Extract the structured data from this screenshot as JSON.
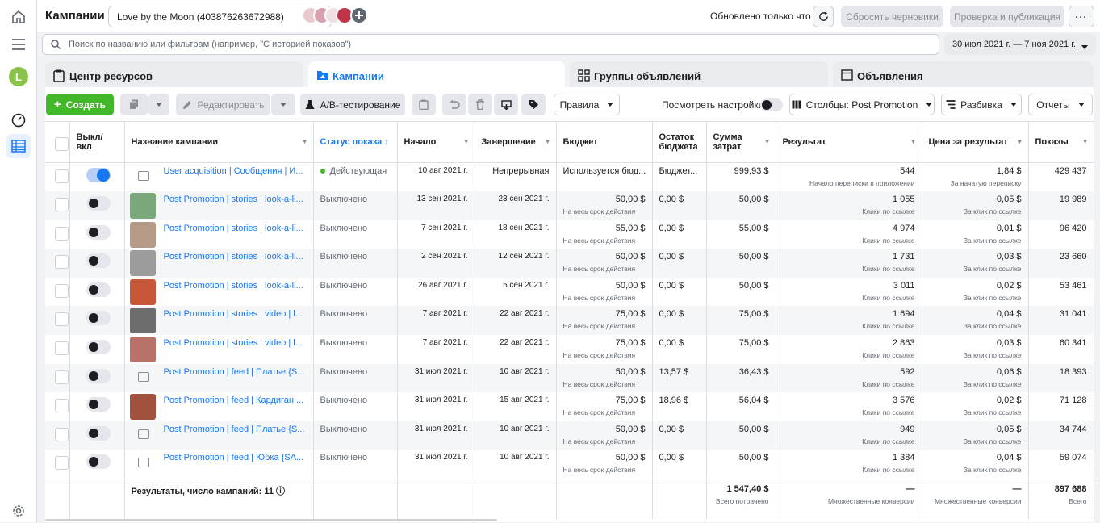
{
  "header": {
    "title": "Кампании",
    "account": "Love by the Moon (403876263672988)",
    "updated": "Обновлено только что",
    "discard_label": "Сбросить черновики",
    "publish_label": "Проверка и публикация",
    "more_label": "···"
  },
  "sidebar": {
    "avatar_letter": "L"
  },
  "search": {
    "placeholder": "Поиск по названию или фильтрам (например, \"С историей показов\")",
    "date_range": "30 июл 2021 г. — 7 ноя 2021 г."
  },
  "tabs": [
    {
      "label": "Центр ресурсов",
      "icon": "clipboard-icon"
    },
    {
      "label": "Кампании",
      "icon": "folder-icon"
    },
    {
      "label": "Группы объявлений",
      "icon": "grid-icon"
    },
    {
      "label": "Объявления",
      "icon": "ad-icon"
    }
  ],
  "toolbar": {
    "create": "Создать",
    "edit": "Редактировать",
    "ab_test": "A/B-тестирование",
    "rules": "Правила",
    "view_settings": "Посмотреть настройки",
    "columns": "Столбцы: Post Promotion",
    "breakdown": "Разбивка",
    "reports": "Отчеты"
  },
  "columns": [
    "Выкл/вкл",
    "Название кампании",
    "Статус показа",
    "Начало",
    "Завершение",
    "Бюджет",
    "Остаток бюджета",
    "Сумма затрат",
    "Результат",
    "Цена за результат",
    "Показы"
  ],
  "rows": [
    {
      "on": true,
      "thumb": "",
      "name": "User acquisition | Сообщения | И...",
      "status": "Действующая",
      "start": "10 авг 2021 г.",
      "end": "Непрерывная",
      "budget": "Используется бюд...",
      "budget_sub": "",
      "remaining": "Бюджет...",
      "spent": "999,93 $",
      "result": "544",
      "result_sub": "Начало переписки в приложении",
      "cpr": "1,84 $",
      "cpr_sub": "За начатую переписку",
      "impr": "429 437"
    },
    {
      "on": false,
      "thumb": "#7aa87a",
      "name": "Post Promotion | stories | look-a-li...",
      "status": "Выключено",
      "start": "13 сен 2021 г.",
      "end": "23 сен 2021 г.",
      "budget": "50,00 $",
      "budget_sub": "На весь срок действия",
      "remaining": "0,00 $",
      "spent": "50,00 $",
      "result": "1 055",
      "result_sub": "Клики по ссылке",
      "cpr": "0,05 $",
      "cpr_sub": "За клик по ссылке",
      "impr": "19 989"
    },
    {
      "on": false,
      "thumb": "#b59a88",
      "name": "Post Promotion | stories | look-a-li...",
      "status": "Выключено",
      "start": "7 сен 2021 г.",
      "end": "18 сен 2021 г.",
      "budget": "55,00 $",
      "budget_sub": "На весь срок действия",
      "remaining": "0,00 $",
      "spent": "55,00 $",
      "result": "4 974",
      "result_sub": "Клики по ссылке",
      "cpr": "0,01 $",
      "cpr_sub": "За клик по ссылке",
      "impr": "96 420"
    },
    {
      "on": false,
      "thumb": "#9c9c9c",
      "name": "Post Promotion | stories | look-a-li...",
      "status": "Выключено",
      "start": "2 сен 2021 г.",
      "end": "12 сен 2021 г.",
      "budget": "50,00 $",
      "budget_sub": "На весь срок действия",
      "remaining": "0,00 $",
      "spent": "50,00 $",
      "result": "1 731",
      "result_sub": "Клики по ссылке",
      "cpr": "0,03 $",
      "cpr_sub": "За клик по ссылке",
      "impr": "23 660"
    },
    {
      "on": false,
      "thumb": "#c8573a",
      "name": "Post Promotion | stories | look-a-li...",
      "status": "Выключено",
      "start": "26 авг 2021 г.",
      "end": "5 сен 2021 г.",
      "budget": "50,00 $",
      "budget_sub": "На весь срок действия",
      "remaining": "0,00 $",
      "spent": "50,00 $",
      "result": "3 011",
      "result_sub": "Клики по ссылке",
      "cpr": "0,02 $",
      "cpr_sub": "За клик по ссылке",
      "impr": "53 461"
    },
    {
      "on": false,
      "thumb": "#6d6d6d",
      "name": "Post Promotion | stories | video | l...",
      "status": "Выключено",
      "start": "7 авг 2021 г.",
      "end": "22 авг 2021 г.",
      "budget": "75,00 $",
      "budget_sub": "На весь срок действия",
      "remaining": "0,00 $",
      "spent": "75,00 $",
      "result": "1 694",
      "result_sub": "Клики по ссылке",
      "cpr": "0,04 $",
      "cpr_sub": "За клик по ссылке",
      "impr": "31 041"
    },
    {
      "on": false,
      "thumb": "#b8726a",
      "name": "Post Promotion | stories | video | l...",
      "status": "Выключено",
      "start": "7 авг 2021 г.",
      "end": "22 авг 2021 г.",
      "budget": "75,00 $",
      "budget_sub": "На весь срок действия",
      "remaining": "0,00 $",
      "spent": "75,00 $",
      "result": "2 863",
      "result_sub": "Клики по ссылке",
      "cpr": "0,03 $",
      "cpr_sub": "За клик по ссылке",
      "impr": "60 341"
    },
    {
      "on": false,
      "thumb": "",
      "name": "Post Promotion | feed | Платье {S...",
      "status": "Выключено",
      "start": "31 июл 2021 г.",
      "end": "10 авг 2021 г.",
      "budget": "50,00 $",
      "budget_sub": "На весь срок действия",
      "remaining": "13,57 $",
      "spent": "36,43 $",
      "result": "592",
      "result_sub": "Клики по ссылке",
      "cpr": "0,06 $",
      "cpr_sub": "За клик по ссылке",
      "impr": "18 393"
    },
    {
      "on": false,
      "thumb": "#a0523d",
      "name": "Post Promotion | feed | Кардиган ...",
      "status": "Выключено",
      "start": "31 июл 2021 г.",
      "end": "15 авг 2021 г.",
      "budget": "75,00 $",
      "budget_sub": "На весь срок действия",
      "remaining": "18,96 $",
      "spent": "56,04 $",
      "result": "3 576",
      "result_sub": "Клики по ссылке",
      "cpr": "0,02 $",
      "cpr_sub": "За клик по ссылке",
      "impr": "71 128"
    },
    {
      "on": false,
      "thumb": "",
      "name": "Post Promotion | feed | Платье {S...",
      "status": "Выключено",
      "start": "31 июл 2021 г.",
      "end": "10 авг 2021 г.",
      "budget": "50,00 $",
      "budget_sub": "На весь срок действия",
      "remaining": "0,00 $",
      "spent": "50,00 $",
      "result": "949",
      "result_sub": "Клики по ссылке",
      "cpr": "0,05 $",
      "cpr_sub": "За клик по ссылке",
      "impr": "34 744"
    },
    {
      "on": false,
      "thumb": "",
      "name": "Post Promotion | feed | Юбка {SA...",
      "status": "Выключено",
      "start": "31 июл 2021 г.",
      "end": "10 авг 2021 г.",
      "budget": "50,00 $",
      "budget_sub": "На весь срок действия",
      "remaining": "0,00 $",
      "spent": "50,00 $",
      "result": "1 384",
      "result_sub": "Клики по ссылке",
      "cpr": "0,04 $",
      "cpr_sub": "За клик по ссылке",
      "impr": "59 074"
    }
  ],
  "footer": {
    "label": "Результаты, число кампаний: 11",
    "spent": "1 547,40 $",
    "spent_sub": "Всего потрачено",
    "result": "—",
    "result_sub": "Множественные конверсии",
    "cpr": "—",
    "cpr_sub": "Множественные конверсии",
    "impr": "897 688",
    "impr_sub": "Всего"
  }
}
